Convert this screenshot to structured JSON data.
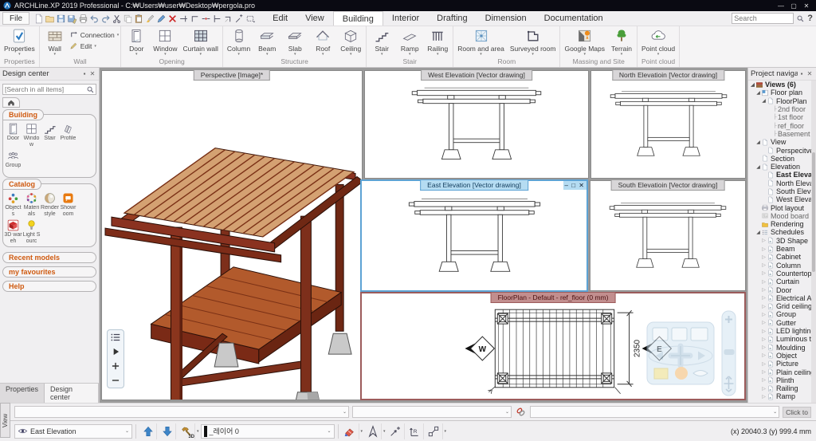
{
  "title_bar": {
    "app_title": "ARCHLine.XP 2019  Professional - C:₩Users₩user₩Desktop₩pergola.pro",
    "minimize": "—",
    "maximize": "▢",
    "close": "✕"
  },
  "menu_bar": {
    "file_label": "File",
    "tabs": [
      {
        "label": "Edit"
      },
      {
        "label": "View"
      },
      {
        "label": "Building",
        "active": true
      },
      {
        "label": "Interior"
      },
      {
        "label": "Drafting"
      },
      {
        "label": "Dimension"
      },
      {
        "label": "Documentation"
      }
    ],
    "search_placeholder": "Search",
    "help_label": "?"
  },
  "quick_access": {
    "icons": [
      "new-doc",
      "open-folder",
      "save",
      "save-as",
      "print",
      "undo",
      "redo",
      "cut",
      "copy",
      "paste",
      "brush",
      "pen",
      "delete-x",
      "trim",
      "corner",
      "break",
      "extend",
      "corner2",
      "query",
      "box-select"
    ]
  },
  "ribbon": {
    "groups": [
      {
        "name": "Properties",
        "items": [
          {
            "label": "Properties",
            "icon": "properties"
          }
        ]
      },
      {
        "name": "Wall",
        "items": [
          {
            "label": "Wall",
            "icon": "wall"
          },
          {
            "label": "Connection",
            "icon": "connection",
            "small": true
          },
          {
            "label": "Edit",
            "icon": "edit-pencil",
            "small": true
          }
        ]
      },
      {
        "name": "Opening",
        "items": [
          {
            "label": "Door",
            "icon": "door"
          },
          {
            "label": "Window",
            "icon": "window"
          },
          {
            "label": "Curtain wall",
            "icon": "curtain-wall"
          }
        ]
      },
      {
        "name": "Structure",
        "items": [
          {
            "label": "Column",
            "icon": "column"
          },
          {
            "label": "Beam",
            "icon": "beam"
          },
          {
            "label": "Slab",
            "icon": "slab"
          },
          {
            "label": "Roof",
            "icon": "roof"
          },
          {
            "label": "Ceiling",
            "icon": "ceiling"
          }
        ]
      },
      {
        "name": "Stair",
        "items": [
          {
            "label": "Stair",
            "icon": "stair"
          },
          {
            "label": "Ramp",
            "icon": "ramp"
          },
          {
            "label": "Railing",
            "icon": "railing"
          }
        ]
      },
      {
        "name": "Room",
        "items": [
          {
            "label": "Room and area",
            "icon": "room-area"
          },
          {
            "label": "Surveyed room",
            "icon": "surveyed-room"
          }
        ]
      },
      {
        "name": "Massing and Site",
        "items": [
          {
            "label": "Google Maps",
            "icon": "google-maps"
          },
          {
            "label": "Terrain",
            "icon": "terrain"
          }
        ]
      },
      {
        "name": "Point cloud",
        "items": [
          {
            "label": "Point cloud",
            "icon": "point-cloud"
          }
        ]
      }
    ]
  },
  "design_center": {
    "title": "Design center",
    "search_placeholder": "[Search in all items]",
    "sections": [
      {
        "label": "Building",
        "items": [
          {
            "label": "Door",
            "icon": "door"
          },
          {
            "label": "Window",
            "icon": "window"
          },
          {
            "label": "Stair",
            "icon": "stair"
          },
          {
            "label": "Profile",
            "icon": "profile"
          },
          {
            "label": "Group",
            "icon": "group-people"
          }
        ]
      },
      {
        "label": "Catalog",
        "items": [
          {
            "label": "Objects",
            "icon": "objects"
          },
          {
            "label": "Materials",
            "icon": "materials"
          },
          {
            "label": "Render style",
            "icon": "render-style"
          },
          {
            "label": "Showroom",
            "icon": "showroom"
          },
          {
            "label": "3D wareh",
            "icon": "warehouse-3d"
          },
          {
            "label": "Light Sourc",
            "icon": "light-source"
          }
        ]
      }
    ],
    "collapsed_sections": [
      {
        "label": "Recent models"
      },
      {
        "label": "my favourites"
      },
      {
        "label": "Help"
      }
    ],
    "footer_tabs": [
      {
        "label": "Properties"
      },
      {
        "label": "Design center",
        "active": true
      }
    ]
  },
  "project_navigator": {
    "title": "Project navigator",
    "tree": [
      {
        "label": "Views (6)",
        "level": 0,
        "icon": "views",
        "expanded": true,
        "bold": true
      },
      {
        "label": "Floor plan",
        "level": 1,
        "icon": "fp",
        "expanded": true
      },
      {
        "label": "FloorPlan",
        "level": 2,
        "icon": "doc",
        "expanded": true
      },
      {
        "label": "2nd floor",
        "level": 3,
        "icon": "fl",
        "gray": true
      },
      {
        "label": "1st floor",
        "level": 3,
        "icon": "fl",
        "gray": true
      },
      {
        "label": "ref_floor",
        "level": 3,
        "icon": "fl",
        "gray": true
      },
      {
        "label": "Basement",
        "level": 3,
        "icon": "fl",
        "gray": true
      },
      {
        "label": "View",
        "level": 1,
        "icon": "doc",
        "expanded": true
      },
      {
        "label": "Perspecitve",
        "level": 2,
        "icon": "doc"
      },
      {
        "label": "Section",
        "level": 1,
        "icon": "doc"
      },
      {
        "label": "Elevation",
        "level": 1,
        "icon": "doc",
        "expanded": true
      },
      {
        "label": "East Elevation",
        "level": 2,
        "icon": "doc",
        "bold": true
      },
      {
        "label": "North Elevatioin",
        "level": 2,
        "icon": "doc"
      },
      {
        "label": "South Elevatioin",
        "level": 2,
        "icon": "doc"
      },
      {
        "label": "West Elevatioin",
        "level": 2,
        "icon": "doc"
      },
      {
        "label": "Plot layout",
        "level": 1,
        "icon": "plot"
      },
      {
        "label": "Mood board",
        "level": 1,
        "icon": "mood",
        "gray": true
      },
      {
        "label": "Rendering",
        "level": 1,
        "icon": "folder"
      },
      {
        "label": "Schedules",
        "level": 1,
        "icon": "sched",
        "expanded": true
      },
      {
        "label": "3D Shape",
        "level": 2,
        "icon": "sdoc",
        "collapsed": true
      },
      {
        "label": "Beam",
        "level": 2,
        "icon": "sdoc",
        "collapsed": true
      },
      {
        "label": "Cabinet",
        "level": 2,
        "icon": "sdoc",
        "collapsed": true
      },
      {
        "label": "Column",
        "level": 2,
        "icon": "sdoc",
        "collapsed": true
      },
      {
        "label": "Countertop",
        "level": 2,
        "icon": "sdoc",
        "collapsed": true
      },
      {
        "label": "Curtain",
        "level": 2,
        "icon": "sdoc",
        "collapsed": true
      },
      {
        "label": "Door",
        "level": 2,
        "icon": "sdoc",
        "collapsed": true
      },
      {
        "label": "Electrical Access",
        "level": 2,
        "icon": "sdoc",
        "collapsed": true
      },
      {
        "label": "Grid ceiling",
        "level": 2,
        "icon": "sdoc",
        "collapsed": true
      },
      {
        "label": "Group",
        "level": 2,
        "icon": "sdoc",
        "collapsed": true
      },
      {
        "label": "Gutter",
        "level": 2,
        "icon": "sdoc",
        "collapsed": true
      },
      {
        "label": "LED lighting",
        "level": 2,
        "icon": "sdoc",
        "collapsed": true
      },
      {
        "label": "Luminous text",
        "level": 2,
        "icon": "sdoc",
        "collapsed": true
      },
      {
        "label": "Moulding",
        "level": 2,
        "icon": "sdoc",
        "collapsed": true
      },
      {
        "label": "Object",
        "level": 2,
        "icon": "sdoc",
        "collapsed": true
      },
      {
        "label": "Picture",
        "level": 2,
        "icon": "sdoc",
        "collapsed": true
      },
      {
        "label": "Plain ceiling",
        "level": 2,
        "icon": "sdoc",
        "collapsed": true
      },
      {
        "label": "Plinth",
        "level": 2,
        "icon": "sdoc",
        "collapsed": true
      },
      {
        "label": "Railing",
        "level": 2,
        "icon": "sdoc",
        "collapsed": true
      },
      {
        "label": "Ramp",
        "level": 2,
        "icon": "sdoc",
        "collapsed": true
      }
    ]
  },
  "viewports": {
    "perspective": {
      "title": "Perspective [Image]*"
    },
    "west": {
      "title": "West Elevatioin [Vector drawing]"
    },
    "north": {
      "title": "North Elevatioin [Vector drawing]"
    },
    "east": {
      "title": "East Elevation [Vector drawing]",
      "minimize": "–",
      "maximize": "□",
      "close": "✕"
    },
    "south": {
      "title": "South Elevatioin [Vector drawing]"
    },
    "floorplan": {
      "title": "FloorPlan - Default - ref_floor (0 mm)",
      "dimension": "2350",
      "marker_west": "W",
      "marker_east": "E"
    }
  },
  "command_bar": {
    "click_to_label": "Click to"
  },
  "status_bar": {
    "left_icons": [
      "settings",
      "grid9",
      "sel-frame",
      "magnet",
      "angle",
      "cursor",
      "ilist"
    ],
    "view_selector": "East Elevation",
    "hammer_sub": "3D",
    "layer_selector": "_레이어 0",
    "coords": "(x) 20040.3    (y) 999.4 mm"
  },
  "side_tab": {
    "label": "View"
  }
}
